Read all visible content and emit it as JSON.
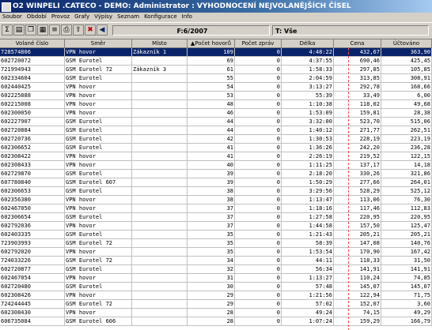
{
  "window": {
    "title": "O2 WINPELI .CATECO - DEMO: Administrator : VYHODNOCENÍ NEJVOLANĚJŠÍCH ČÍSEL"
  },
  "menu": [
    "Soubor",
    "Období",
    "Provoz",
    "Grafy",
    "Výpisy",
    "Seznam",
    "Konfigurace",
    "Info"
  ],
  "toolbar": {
    "icons": [
      "sum-icon",
      "report-icon",
      "copy-icon",
      "grid-icon",
      "list-icon",
      "print-icon",
      "export-icon",
      "delete-icon",
      "back-arrow-icon"
    ],
    "period": "F:6/2007",
    "type_filter": "T: Vše"
  },
  "table": {
    "columns": [
      "Volané číslo",
      "Směr",
      "Místo",
      "▲Počet hovorů",
      "Počet zpráv",
      "Délka",
      "Cena",
      "Účtováno"
    ],
    "rows": [
      [
        "728574806",
        "VPN hovor",
        "Zákazník 1",
        "109",
        "0",
        "4:48:22",
        "432,67",
        "363,90"
      ],
      [
        "602720072",
        "GSM Eurotel",
        "",
        "69",
        "0",
        "4:37:55",
        "690,46",
        "425,45"
      ],
      [
        "721994943",
        "GSM Eurotel 72",
        "Zákazník 3",
        "61",
        "0",
        "1:58:33",
        "297,85",
        "105,85"
      ],
      [
        "602334604",
        "GSM Eurotel",
        "",
        "55",
        "0",
        "2:04:59",
        "313,85",
        "308,91"
      ],
      [
        "602440425",
        "VPN hovor",
        "",
        "54",
        "0",
        "3:13:27",
        "292,78",
        "168,66"
      ],
      [
        "602225888",
        "VPN hovor",
        "",
        "53",
        "0",
        "55:39",
        "33,49",
        "6,00"
      ],
      [
        "602215008",
        "VPN hovor",
        "",
        "48",
        "0",
        "1:10:38",
        "118,02",
        "49,68"
      ],
      [
        "602300050",
        "VPN hovor",
        "",
        "46",
        "0",
        "1:53:09",
        "159,81",
        "28,38"
      ],
      [
        "602227907",
        "GSM Eurotel",
        "",
        "44",
        "0",
        "3:32:00",
        "523,70",
        "515,06"
      ],
      [
        "602720884",
        "GSM Eurotel",
        "",
        "44",
        "0",
        "1:40:12",
        "271,77",
        "262,51"
      ],
      [
        "602720736",
        "GSM Eurotel",
        "",
        "42",
        "0",
        "1:30:53",
        "228,19",
        "223,19"
      ],
      [
        "602306652",
        "GSM Eurotel",
        "",
        "41",
        "0",
        "1:36:26",
        "242,20",
        "236,28"
      ],
      [
        "602308422",
        "VPN hovor",
        "",
        "41",
        "0",
        "2:26:19",
        "219,52",
        "122,15"
      ],
      [
        "602308433",
        "VPN hovor",
        "",
        "40",
        "0",
        "1:11:25",
        "137,17",
        "14,18"
      ],
      [
        "602729870",
        "GSM Eurotel",
        "",
        "39",
        "0",
        "2:18:20",
        "330,26",
        "321,86"
      ],
      [
        "607780840",
        "GSM Eurotel 607",
        "",
        "39",
        "0",
        "1:50:29",
        "277,66",
        "264,01"
      ],
      [
        "602306653",
        "GSM Eurotel",
        "",
        "38",
        "0",
        "3:29:56",
        "528,29",
        "525,12"
      ],
      [
        "602356380",
        "VPN hovor",
        "",
        "38",
        "0",
        "1:13:47",
        "113,06",
        "76,30"
      ],
      [
        "602467050",
        "VPN hovor",
        "",
        "37",
        "0",
        "1:18:16",
        "117,46",
        "112,83"
      ],
      [
        "602306654",
        "GSM Eurotel",
        "",
        "37",
        "0",
        "1:27:58",
        "220,95",
        "220,95"
      ],
      [
        "602792036",
        "VPN hovor",
        "",
        "37",
        "0",
        "1:44:58",
        "157,50",
        "125,47"
      ],
      [
        "602403335",
        "GSM Eurotel",
        "",
        "35",
        "0",
        "1:21:43",
        "205,21",
        "205,21"
      ],
      [
        "723903993",
        "GSM Eurotel 72",
        "",
        "35",
        "0",
        "58:39",
        "147,08",
        "140,76"
      ],
      [
        "602792020",
        "VPN hovor",
        "",
        "35",
        "0",
        "1:53:54",
        "170,90",
        "167,42"
      ],
      [
        "724033226",
        "GSM Eurotel 72",
        "",
        "34",
        "0",
        "44:11",
        "118,33",
        "31,50"
      ],
      [
        "602720877",
        "GSM Eurotel",
        "",
        "32",
        "0",
        "56:34",
        "141,91",
        "141,91"
      ],
      [
        "602467054",
        "VPN hovor",
        "",
        "31",
        "0",
        "1:13:27",
        "110,24",
        "74,85"
      ],
      [
        "602720480",
        "GSM Eurotel",
        "",
        "30",
        "0",
        "57:48",
        "145,07",
        "145,07"
      ],
      [
        "602308426",
        "VPN hovor",
        "",
        "29",
        "0",
        "1:21:56",
        "122,94",
        "71,75"
      ],
      [
        "724244445",
        "GSM Eurotel 72",
        "",
        "29",
        "0",
        "57:02",
        "152,07",
        "3,60"
      ],
      [
        "602308430",
        "VPN hovor",
        "",
        "28",
        "0",
        "49:24",
        "74,15",
        "49,29"
      ],
      [
        "606735084",
        "GSM Eurotel 606",
        "",
        "28",
        "0",
        "1:07:24",
        "159,29",
        "166,79"
      ]
    ]
  }
}
